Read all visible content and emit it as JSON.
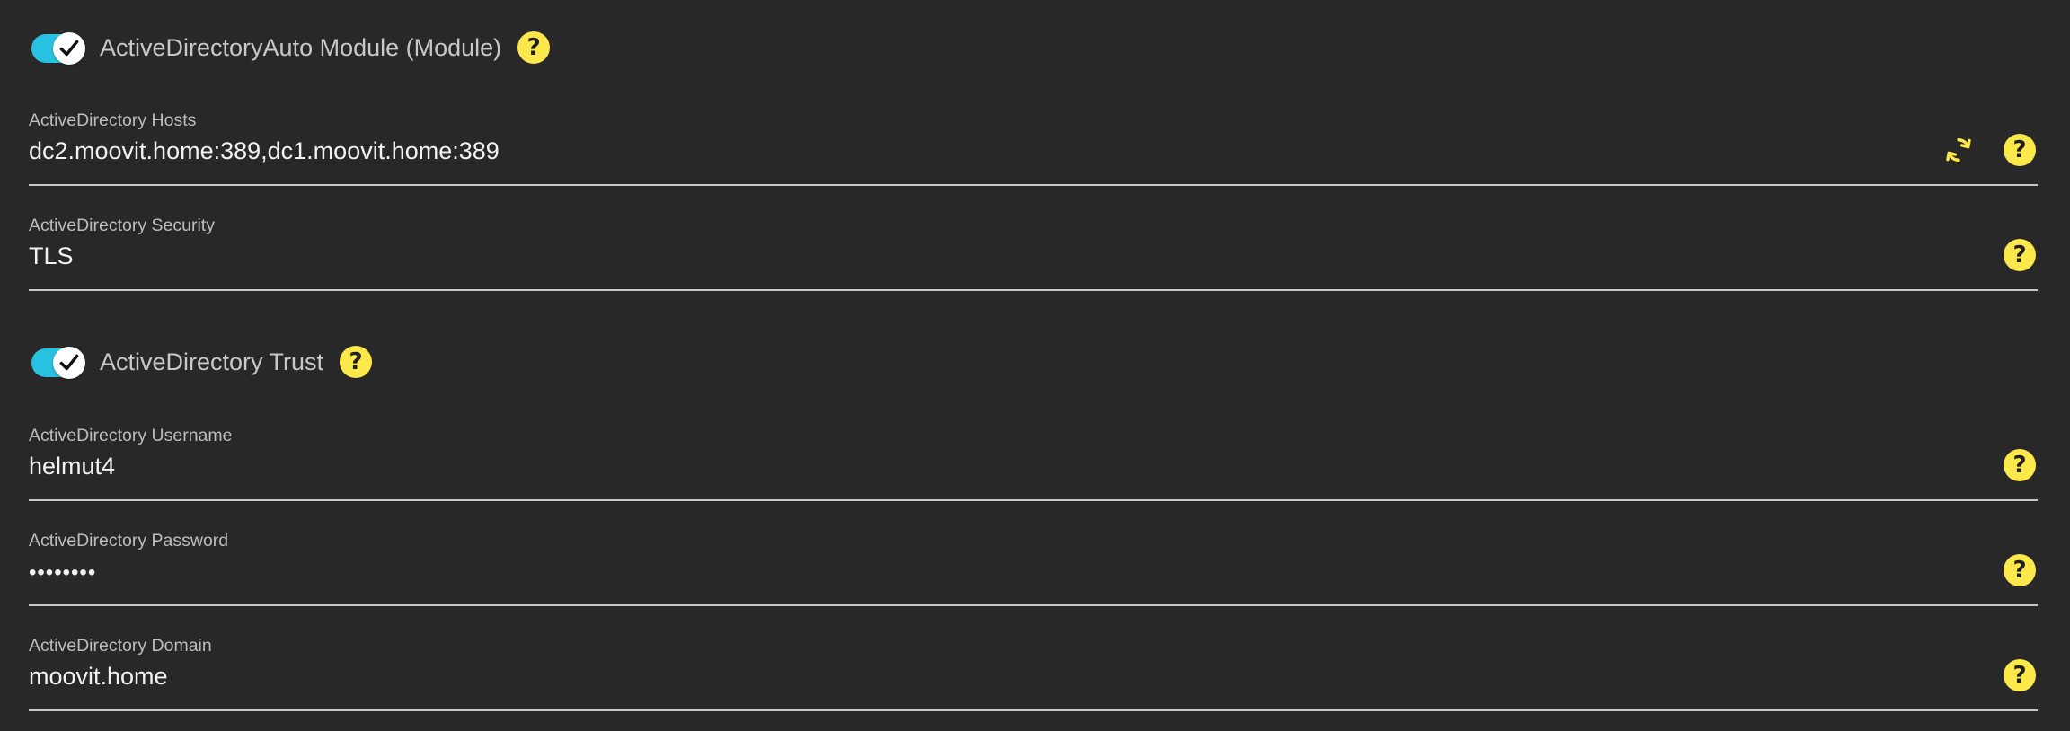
{
  "modules": {
    "auto_module": {
      "label": "ActiveDirectoryAuto Module (Module)",
      "enabled": true
    },
    "trust": {
      "label": "ActiveDirectory Trust",
      "enabled": true
    }
  },
  "fields": {
    "hosts": {
      "label": "ActiveDirectory Hosts",
      "value": "dc2.moovit.home:389,dc1.moovit.home:389"
    },
    "security": {
      "label": "ActiveDirectory Security",
      "value": "TLS"
    },
    "username": {
      "label": "ActiveDirectory Username",
      "value": "helmut4"
    },
    "password": {
      "label": "ActiveDirectory Password",
      "value": "••••••••"
    },
    "domain": {
      "label": "ActiveDirectory Domain",
      "value": "moovit.home"
    }
  },
  "help_glyph": "?",
  "icons": {
    "help": "help-icon",
    "refresh": "refresh-icon",
    "check": "checkmark-icon"
  },
  "colors": {
    "background": "#282828",
    "toggle_track": "#27c2e2",
    "help_icon": "#fde84b",
    "refresh_icon": "#fde84b"
  }
}
